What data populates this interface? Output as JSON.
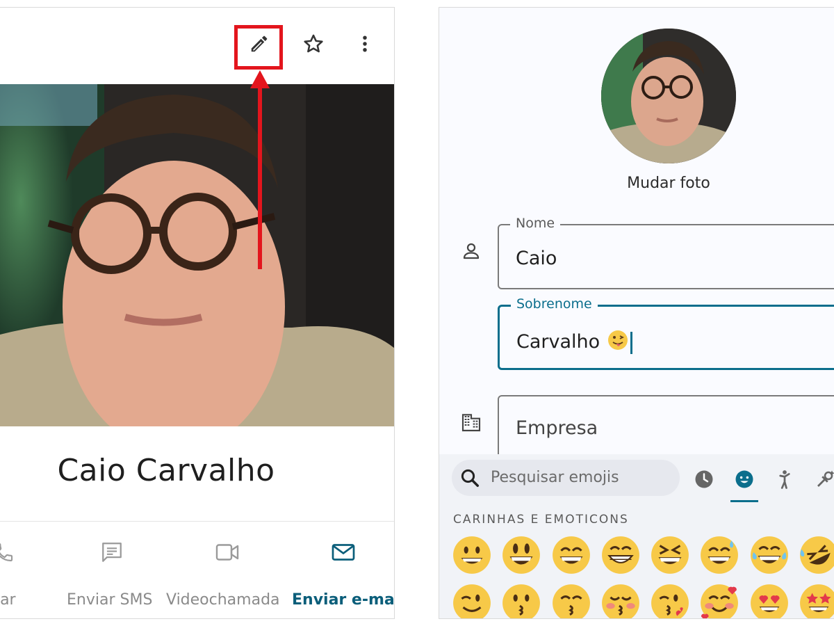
{
  "left_panel": {
    "contact_name": "Caio Carvalho",
    "toolbar": {
      "edit_icon": "pencil-icon",
      "star_icon": "star-outline-icon",
      "more_icon": "more-vert-icon"
    },
    "actions": [
      {
        "label": "igar",
        "icon": "phone-icon"
      },
      {
        "label": "Enviar SMS",
        "icon": "message-icon"
      },
      {
        "label": "Videochamada",
        "icon": "video-icon"
      },
      {
        "label": "Enviar e-mail",
        "icon": "mail-icon"
      }
    ],
    "colors": {
      "highlight": "#e3151d",
      "active_action": "#0b5e7a"
    }
  },
  "right_panel": {
    "change_photo_label": "Mudar foto",
    "fields": {
      "first_name": {
        "label": "Nome",
        "value": "Caio"
      },
      "last_name": {
        "label": "Sobrenome",
        "value": "Carvalho"
      },
      "company": {
        "placeholder": "Empresa"
      }
    },
    "emoji_picker": {
      "search_placeholder": "Pesquisar emojis",
      "categories": [
        "recent-icon",
        "smiley-icon",
        "person-icon",
        "activity-icon"
      ],
      "active_category": "smiley-icon",
      "section_title": "CARINHAS E EMOTICONS",
      "emojis": [
        "😀",
        "😃",
        "😄",
        "😁",
        "😆",
        "😅",
        "😂",
        "🤣",
        "😉",
        "😗",
        "😙",
        "😚",
        "😘",
        "🥰",
        "😍",
        "🤩"
      ]
    },
    "colors": {
      "accent": "#0b6e8c"
    }
  }
}
